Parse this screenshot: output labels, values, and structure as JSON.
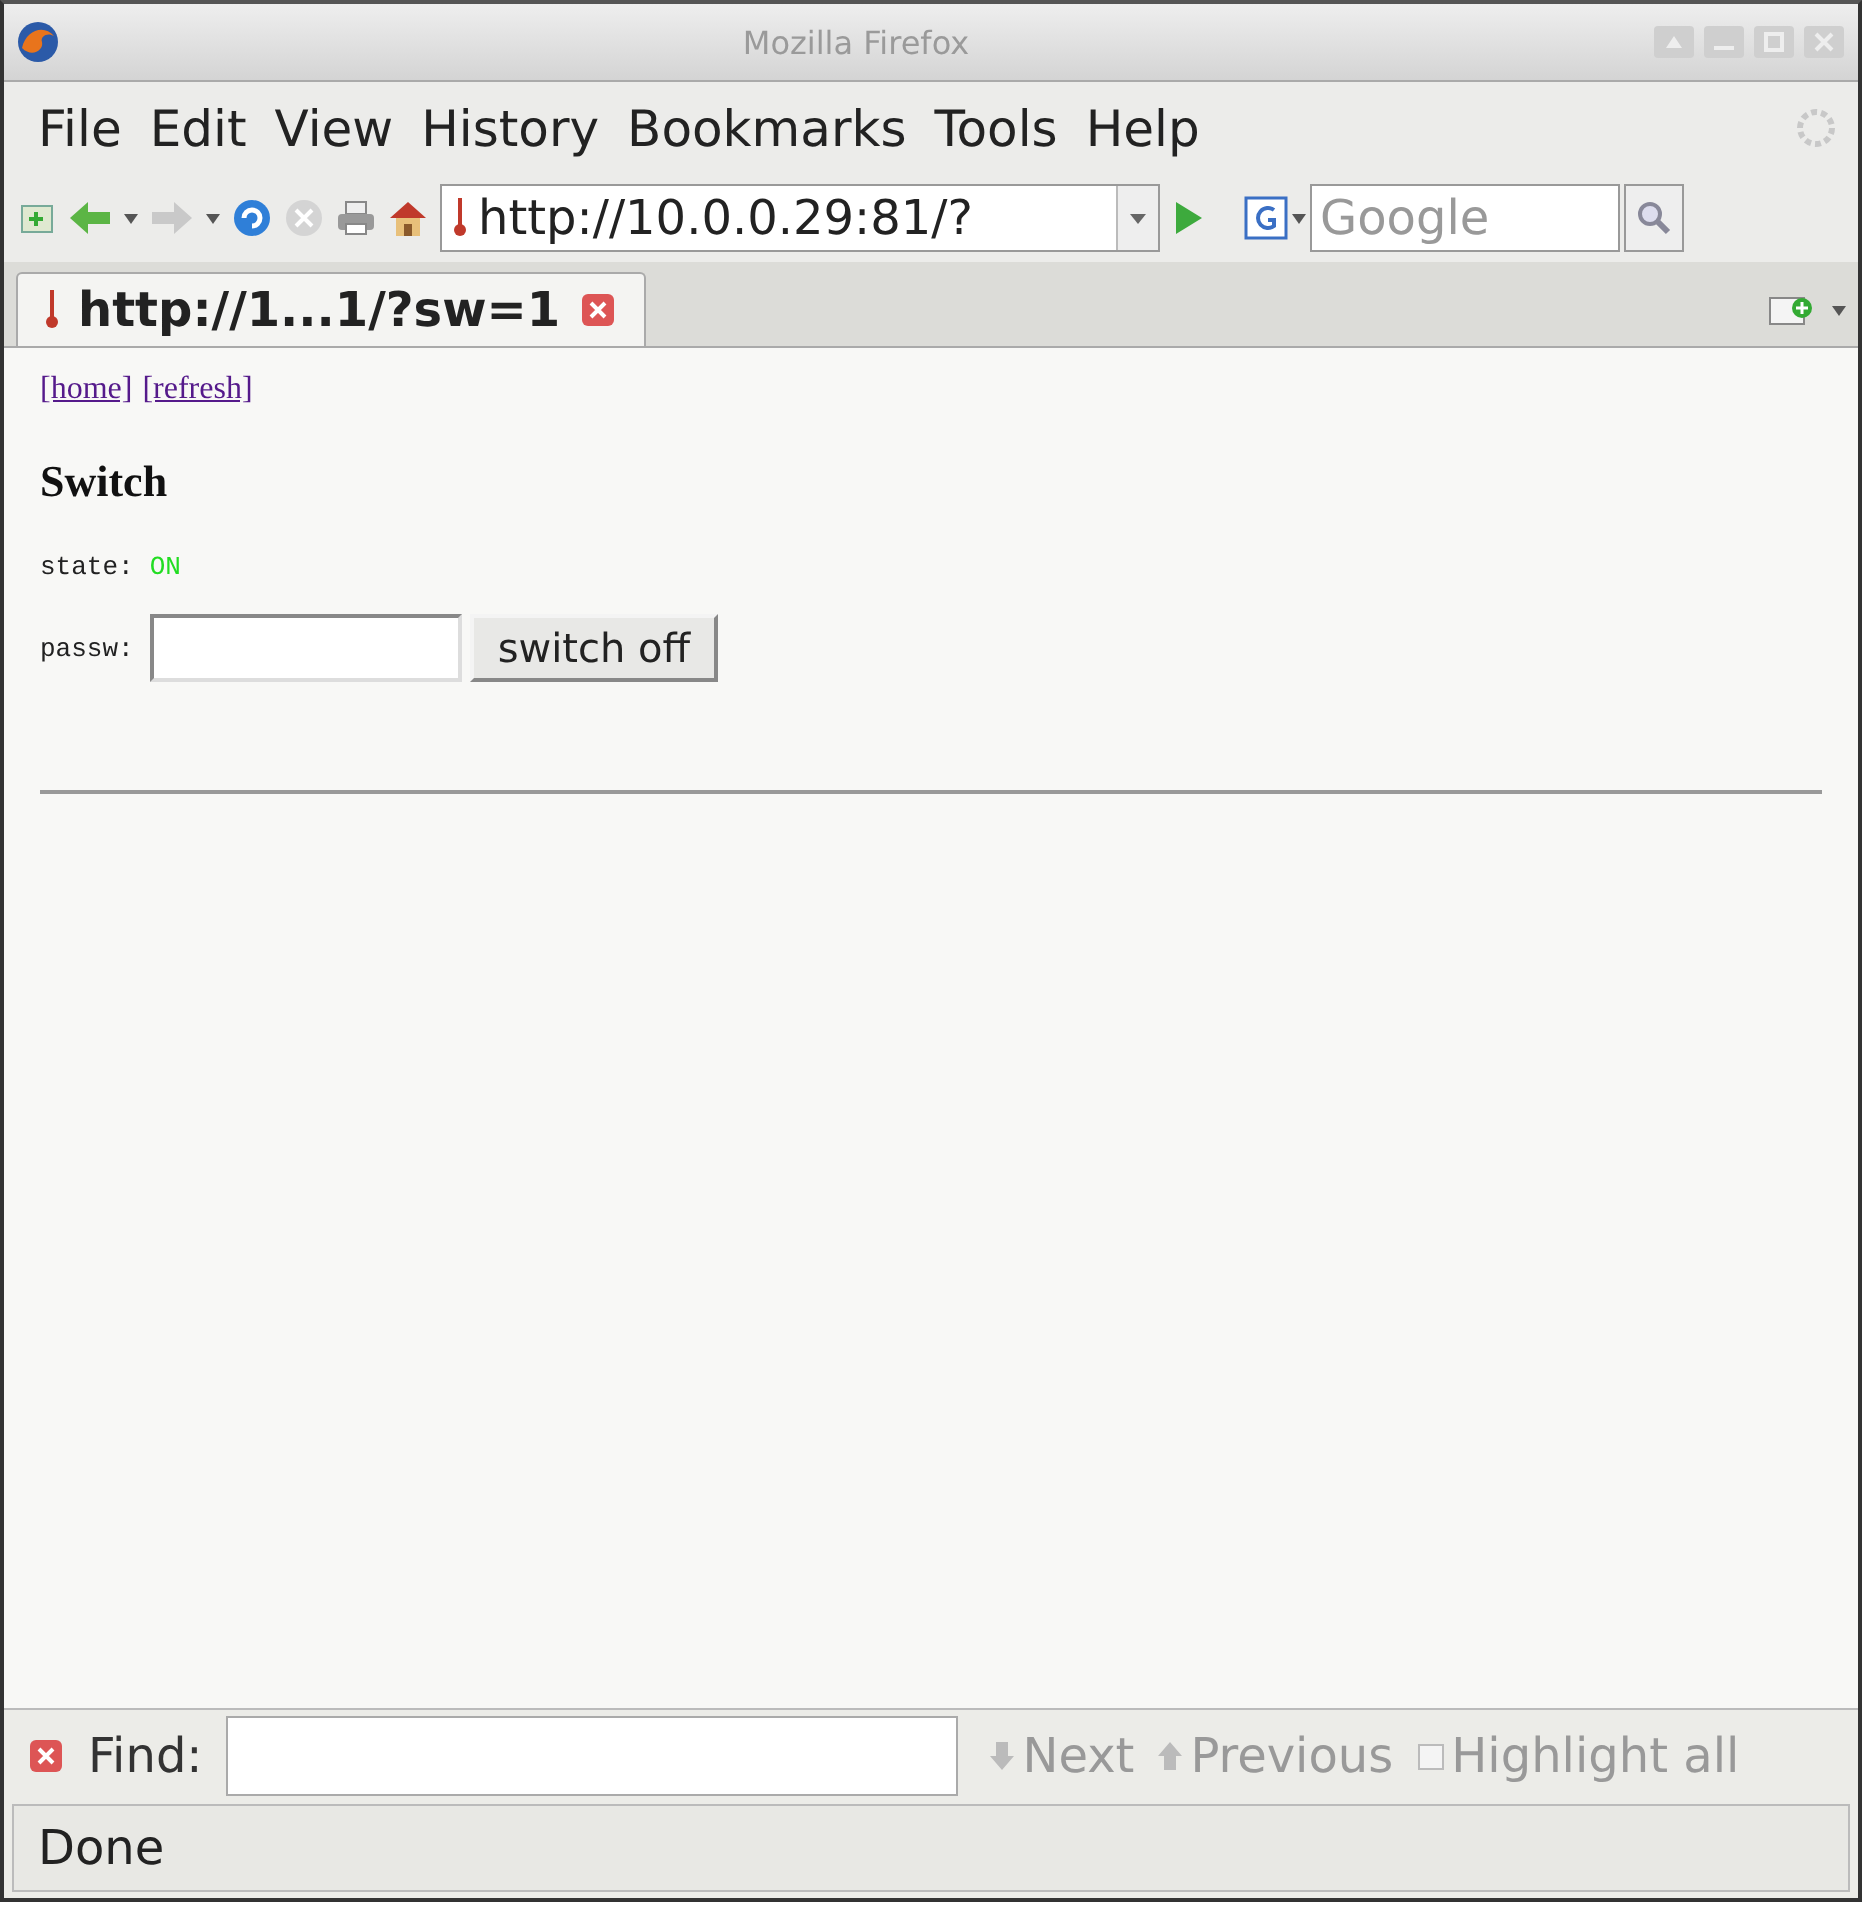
{
  "window": {
    "title": "Mozilla Firefox"
  },
  "menu": [
    "File",
    "Edit",
    "View",
    "History",
    "Bookmarks",
    "Tools",
    "Help"
  ],
  "toolbar": {
    "url": "http://10.0.0.29:81/?",
    "search": {
      "placeholder": "Google"
    }
  },
  "tabs": [
    {
      "label": "http://1...1/?sw=1",
      "selected": true
    }
  ],
  "page": {
    "links": [
      "[home]",
      "[refresh]"
    ],
    "heading": "Switch",
    "state_label": "state:",
    "state_value": "ON",
    "state_on": true,
    "password_label": "passw:",
    "button": "switch off"
  },
  "find_bar": {
    "label": "Find:",
    "next": "Next",
    "previous": "Previous",
    "highlight": "Highlight all",
    "highlight_checked": false
  },
  "status_bar": "Done"
}
